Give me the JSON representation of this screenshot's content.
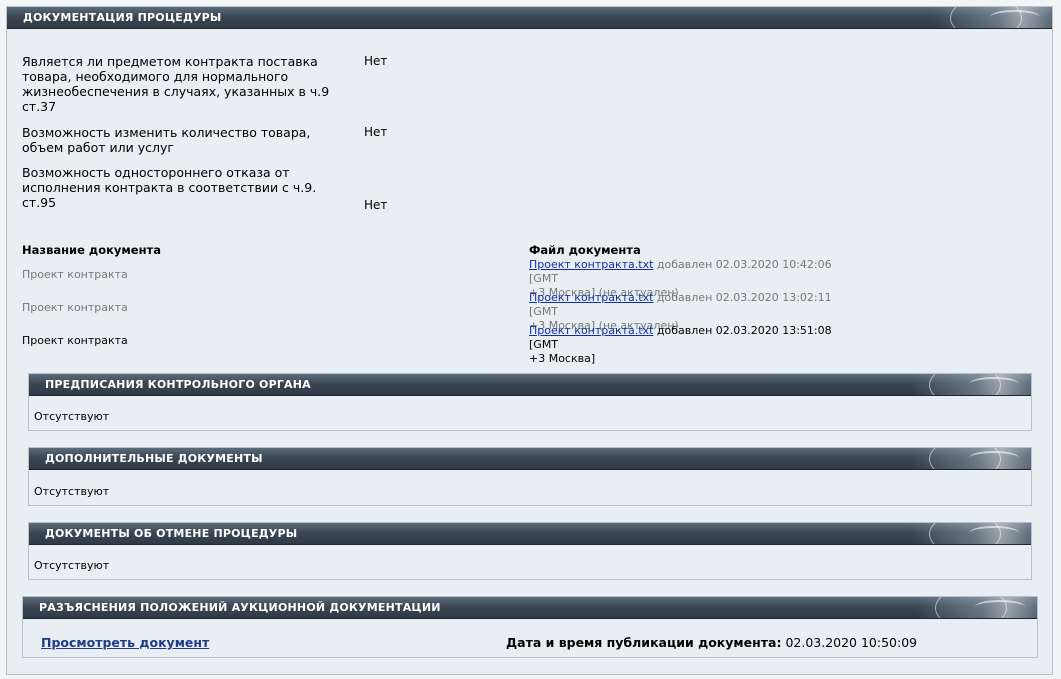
{
  "main_section": {
    "title": "ДОКУМЕНТАЦИЯ ПРОЦЕДУРЫ",
    "questions": [
      {
        "label": "Является ли предметом контракта поставка товара, необходимого для нормального жизнеобеспечения в случаях, указанных в ч.9 ст.37",
        "value": "Нет"
      },
      {
        "label": "Возможность изменить количество товара, объем работ или услуг",
        "value": "Нет"
      },
      {
        "label": "Возможность одностороннего отказа от исполнения контракта в соответствии с ч.9. ст.95",
        "value": "Нет"
      }
    ],
    "doc_table": {
      "col_name_header": "Название документа",
      "col_file_header": "Файл документа",
      "rows": [
        {
          "name": "Проект контракта",
          "file_link": "Проект контракта.txt",
          "meta_line1": "добавлен 02.03.2020 10:42:06 [GMT",
          "meta_line2": "+3 Москва] (не актуален)"
        },
        {
          "name": "Проект контракта",
          "file_link": "Проект контракта.txt",
          "meta_line1": "добавлен 02.03.2020 13:02:11 [GMT",
          "meta_line2": "+3 Москва] (не актуален)"
        },
        {
          "name": "Проект контракта",
          "file_link": "Проект контракта.txt",
          "meta_line1": "добавлен 02.03.2020 13:51:08 [GMT",
          "meta_line2": "+3 Москва]"
        }
      ]
    }
  },
  "sections": [
    {
      "title": "ПРЕДПИСАНИЯ КОНТРОЛЬНОГО ОРГАНА",
      "text": "Отсутствуют"
    },
    {
      "title": "ДОПОЛНИТЕЛЬНЫЕ ДОКУМЕНТЫ",
      "text": "Отсутствуют"
    },
    {
      "title": "ДОКУМЕНТЫ ОБ ОТМЕНЕ ПРОЦЕДУРЫ",
      "text": "Отсутствуют"
    }
  ],
  "clarifications": {
    "title": "РАЗЪЯСНЕНИЯ ПОЛОЖЕНИЙ АУКЦИОННОЙ ДОКУМЕНТАЦИИ",
    "view_link": "Просмотреть документ",
    "pub_label": "Дата и время публикации документа:",
    "pub_value": "02.03.2020 10:50:09"
  }
}
